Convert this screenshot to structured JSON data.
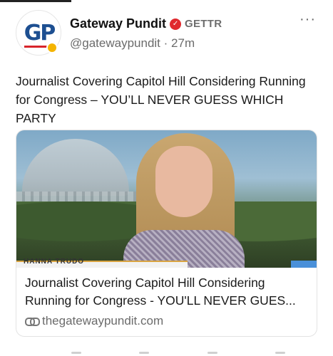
{
  "post": {
    "author": {
      "display_name": "Gateway Pundit",
      "platform_label": "GETTR",
      "handle": "@gatewaypundit",
      "separator": "·",
      "time_ago": "27m",
      "avatar_text": "GP",
      "verified_icon": "verified-badge-icon"
    },
    "more_label": "···",
    "text": "Journalist Covering Capitol Hill Considering Running for Congress – YOU’LL NEVER GUESS WHICH PARTY",
    "link_card": {
      "title": "Journalist Covering Capitol Hill Considering Running for Congress - YOU'LL NEVER GUES...",
      "domain": "thegatewaypundit.com",
      "image_caption": "HANNA TRUDO",
      "link_icon": "link-icon"
    }
  },
  "colors": {
    "accent_red": "#e0292e",
    "brand_blue": "#1d4f91",
    "muted_text": "#6b6b6b"
  }
}
